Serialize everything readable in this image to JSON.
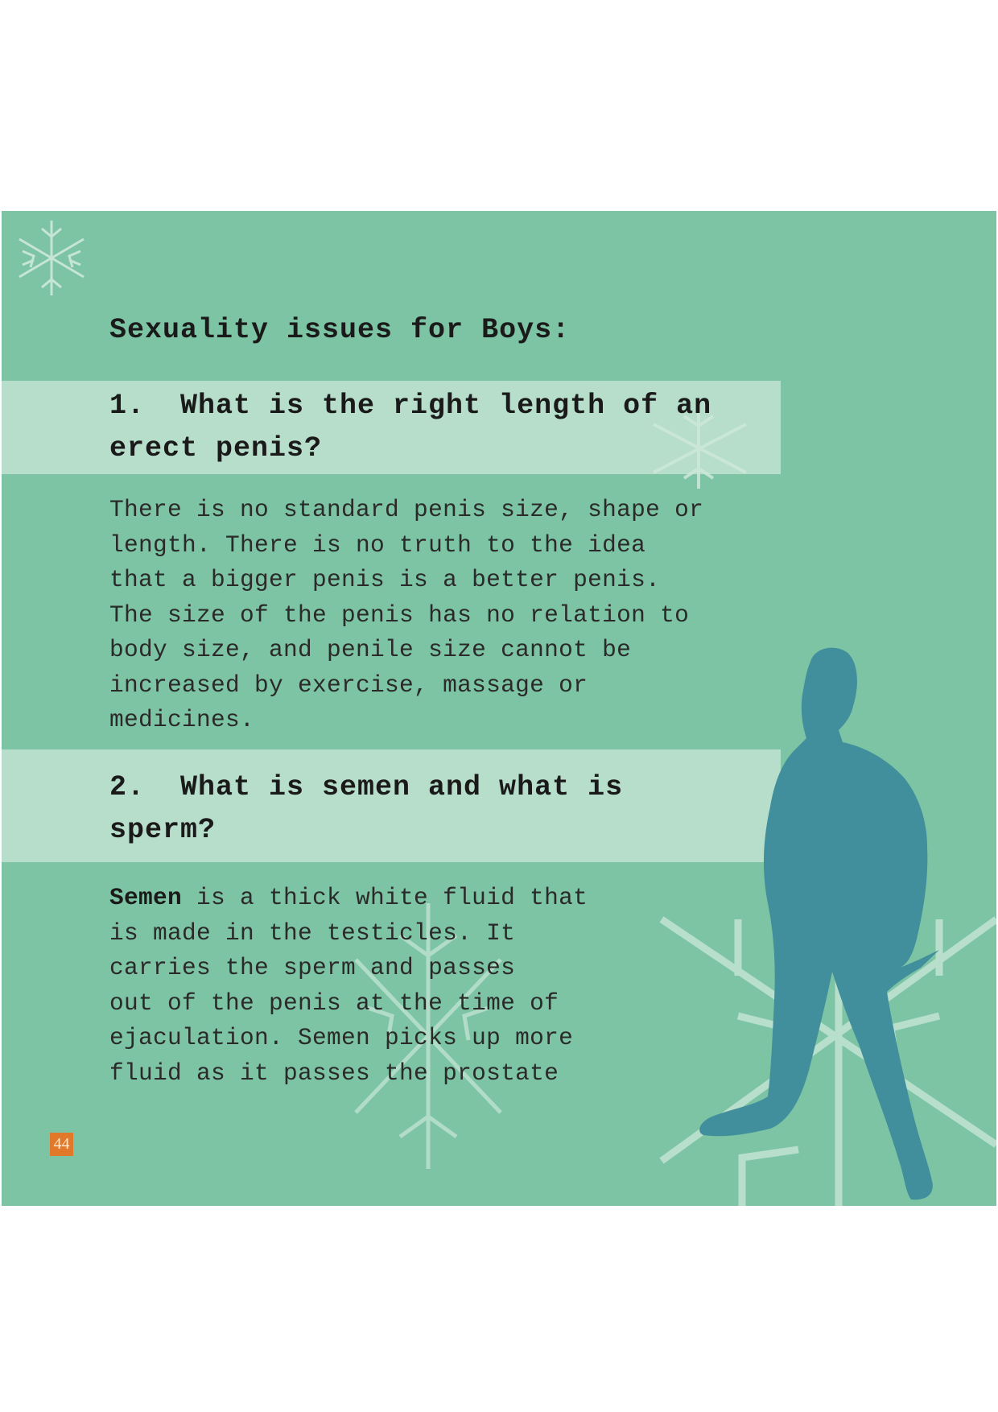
{
  "page": {
    "title": "Sexuality issues for Boys:",
    "page_number": "44"
  },
  "sections": [
    {
      "number": "1.",
      "question_line1": "What is the right length of an",
      "question_line2": "erect penis?",
      "paragraph": [
        "There is no standard penis size, shape or",
        "length. There is no truth to the idea",
        "that a bigger penis is a better penis.",
        "The size of the penis has no relation to",
        "body size, and penile size cannot be",
        "increased by exercise, massage or",
        "medicines."
      ]
    },
    {
      "number": "2.",
      "question_line1": "What is semen and what is",
      "question_line2": "sperm?",
      "term": "Semen",
      "paragraph": [
        " is a thick white fluid that",
        "is made in the testicles. It",
        "carries the sperm and passes",
        "out of the penis at the time of",
        "ejaculation. Semen picks up more",
        "fluid as it passes the prostate"
      ]
    }
  ],
  "colors": {
    "panel": "#7cc4a4",
    "band": "#c8e6d6",
    "silhouette": "#418f9c",
    "page_badge": "#e07a2a"
  },
  "icons": [
    "snowflake-icon",
    "man-silhouette"
  ]
}
